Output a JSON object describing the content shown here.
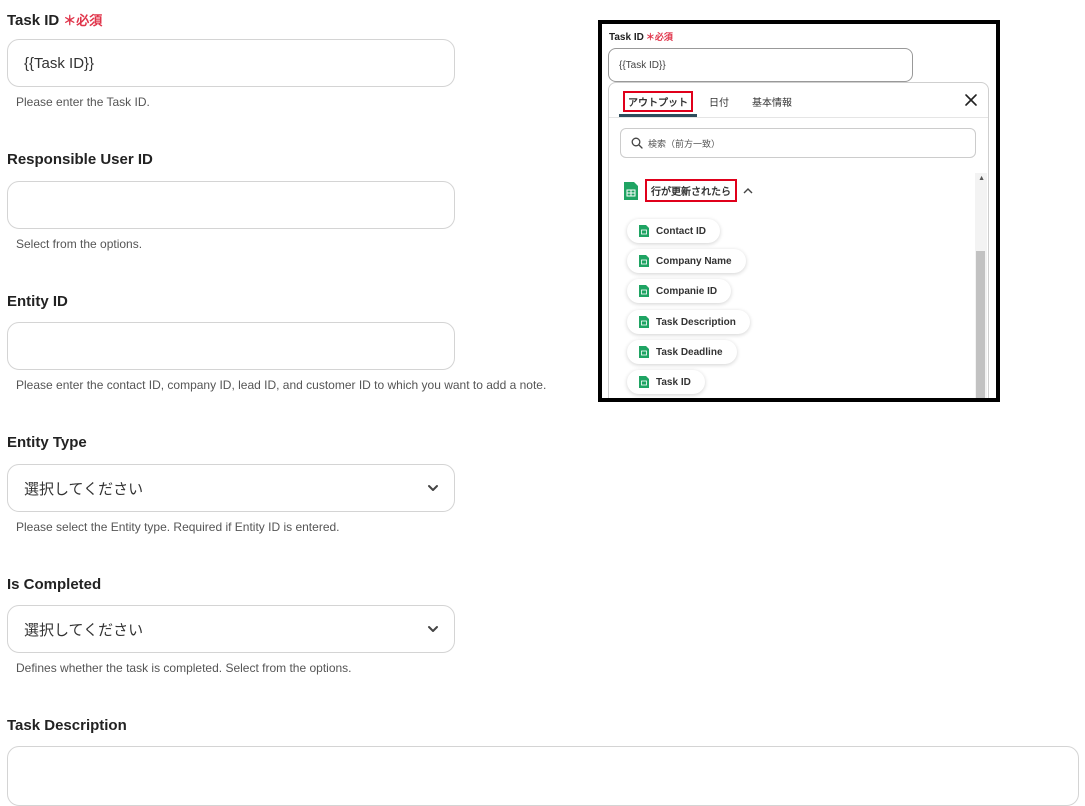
{
  "form": {
    "task_id": {
      "label": "Task ID",
      "required_mark": "＊必須",
      "value": "{{Task ID}}",
      "help": "Please enter the Task ID."
    },
    "responsible_user_id": {
      "label": "Responsible User ID",
      "value": "",
      "help": "Select from the options."
    },
    "entity_id": {
      "label": "Entity ID",
      "value": "",
      "help": "Please enter the contact ID, company ID, lead ID, and customer ID to which you want to add a note."
    },
    "entity_type": {
      "label": "Entity Type",
      "value": "選択してください",
      "help": "Please select the Entity type. Required if Entity ID is entered."
    },
    "is_completed": {
      "label": "Is Completed",
      "value": "選択してください",
      "help": "Defines whether the task is completed. Select from the options."
    },
    "task_description": {
      "label": "Task Description",
      "value": ""
    }
  },
  "inset": {
    "label": "Task ID",
    "required_mark": "＊必須",
    "field_value": "{{Task ID}}",
    "tabs": [
      "アウトプット",
      "日付",
      "基本情報"
    ],
    "search_placeholder": "検索（前方一致）",
    "group_title": "行が更新されたら",
    "items": [
      "Contact ID",
      "Company Name",
      "Companie ID",
      "Task Description",
      "Task Deadline",
      "Task ID"
    ],
    "colors": {
      "highlight": "#e0001b",
      "sheets_green": "#1fa463"
    }
  }
}
